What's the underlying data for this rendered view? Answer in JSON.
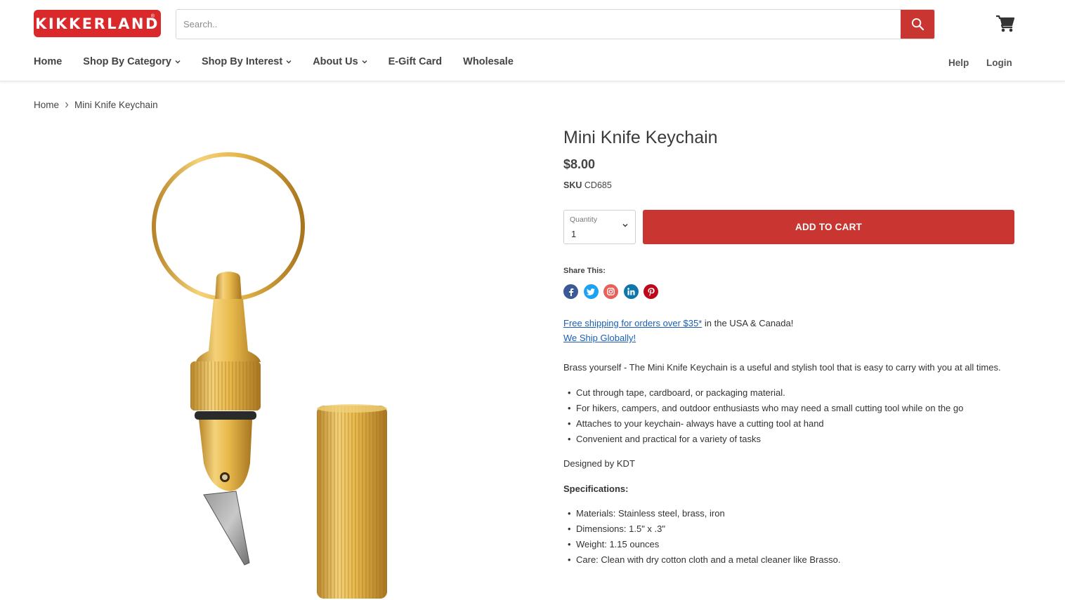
{
  "brand": {
    "logo_text": "KIKKERLAND",
    "reg_mark": "®",
    "accent_color": "#c93631"
  },
  "search": {
    "placeholder": "Search.."
  },
  "nav": {
    "items": [
      {
        "label": "Home",
        "has_dropdown": false
      },
      {
        "label": "Shop By Category",
        "has_dropdown": true
      },
      {
        "label": "Shop By Interest",
        "has_dropdown": true
      },
      {
        "label": "About Us",
        "has_dropdown": true
      },
      {
        "label": "E-Gift Card",
        "has_dropdown": false
      },
      {
        "label": "Wholesale",
        "has_dropdown": false
      }
    ],
    "help": "Help",
    "login": "Login"
  },
  "breadcrumb": {
    "home": "Home",
    "current": "Mini Knife Keychain"
  },
  "product": {
    "title": "Mini Knife Keychain",
    "price": "$8.00",
    "sku_label": "SKU",
    "sku_value": "CD685",
    "quantity_label": "Quantity",
    "quantity_value": "1",
    "add_to_cart": "ADD TO CART",
    "share_label": "Share This:",
    "share_icons": [
      "facebook-icon",
      "twitter-icon",
      "instagram-icon",
      "linkedin-icon",
      "pinterest-icon"
    ],
    "shipping_link": "Free shipping for orders over $35*",
    "shipping_rest": " in the USA & Canada!",
    "global_link": "We Ship Globally!",
    "description": "Brass yourself - The Mini Knife Keychain is a useful and stylish tool that is easy to carry with you at all times.",
    "features": [
      "Cut through tape, cardboard, or packaging material.",
      "For hikers, campers, and outdoor enthusiasts who may need a small cutting tool while on the go",
      "Attaches to your keychain- always have a cutting tool at hand",
      "Convenient and practical for a variety of tasks"
    ],
    "designer": "Designed by KDT",
    "specs_heading": "Specifications:",
    "specs": [
      "Materials: Stainless steel, brass, iron",
      "Dimensions: 1.5\" x .3\"",
      "Weight: 1.15 ounces",
      "Care: Clean with dry cotton cloth and a metal cleaner like Brasso."
    ]
  }
}
